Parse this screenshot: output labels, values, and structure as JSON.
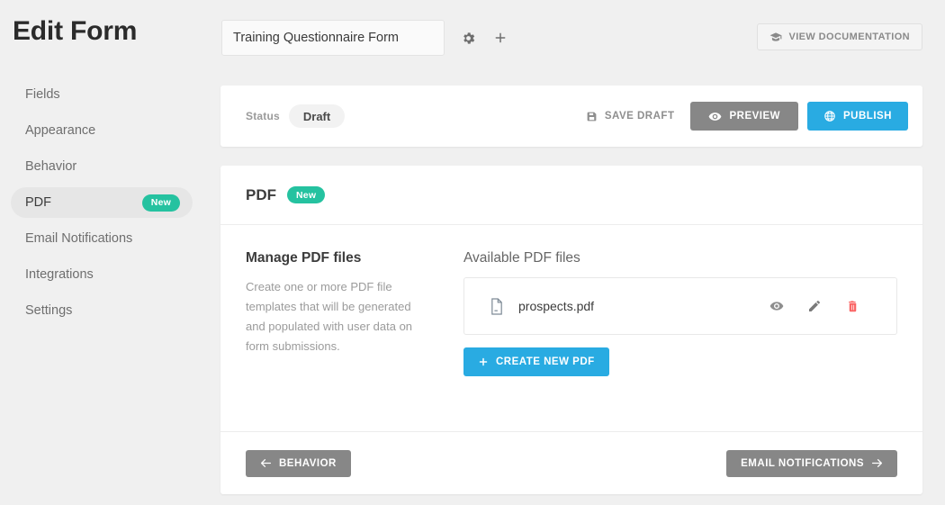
{
  "header": {
    "page_title": "Edit Form",
    "form_title_value": "Training Questionnaire Form",
    "form_title_placeholder": "Form title",
    "gear_icon": "gear-icon",
    "plus_icon": "plus-icon",
    "documentation_button": "VIEW DOCUMENTATION",
    "documentation_icon": "graduation-cap-icon"
  },
  "sidebar": {
    "items": [
      {
        "label": "Fields",
        "active": false,
        "badge": ""
      },
      {
        "label": "Appearance",
        "active": false,
        "badge": ""
      },
      {
        "label": "Behavior",
        "active": false,
        "badge": ""
      },
      {
        "label": "PDF",
        "active": true,
        "badge": "New"
      },
      {
        "label": "Email Notifications",
        "active": false,
        "badge": ""
      },
      {
        "label": "Integrations",
        "active": false,
        "badge": ""
      },
      {
        "label": "Settings",
        "active": false,
        "badge": ""
      }
    ]
  },
  "status_bar": {
    "status_label": "Status",
    "status_value": "Draft",
    "save_draft_label": "SAVE DRAFT",
    "save_draft_icon": "floppy-disk-icon",
    "preview_label": "PREVIEW",
    "preview_icon": "eye-icon",
    "publish_label": "PUBLISH",
    "publish_icon": "globe-icon"
  },
  "pdf_section": {
    "heading": "PDF",
    "heading_badge": "New",
    "manage": {
      "title": "Manage PDF files",
      "description": "Create one or more PDF file templates that will be generated and populated with user data on form submissions."
    },
    "available": {
      "title": "Available PDF files",
      "files": [
        {
          "name": "prospects.pdf",
          "file_icon": "document-icon",
          "view_icon": "eye-icon",
          "edit_icon": "pencil-icon",
          "delete_icon": "trash-icon"
        }
      ],
      "create_button": "CREATE NEW PDF",
      "create_icon": "plus-icon"
    },
    "footer": {
      "prev_label": "BEHAVIOR",
      "prev_icon": "arrow-left-icon",
      "next_label": "EMAIL NOTIFICATIONS",
      "next_icon": "arrow-right-icon"
    }
  },
  "colors": {
    "accent_blue": "#29abe2",
    "badge_green": "#25c2a0",
    "button_gray": "#878787",
    "delete_red": "#fa6464",
    "page_background": "#f0f0f0"
  }
}
